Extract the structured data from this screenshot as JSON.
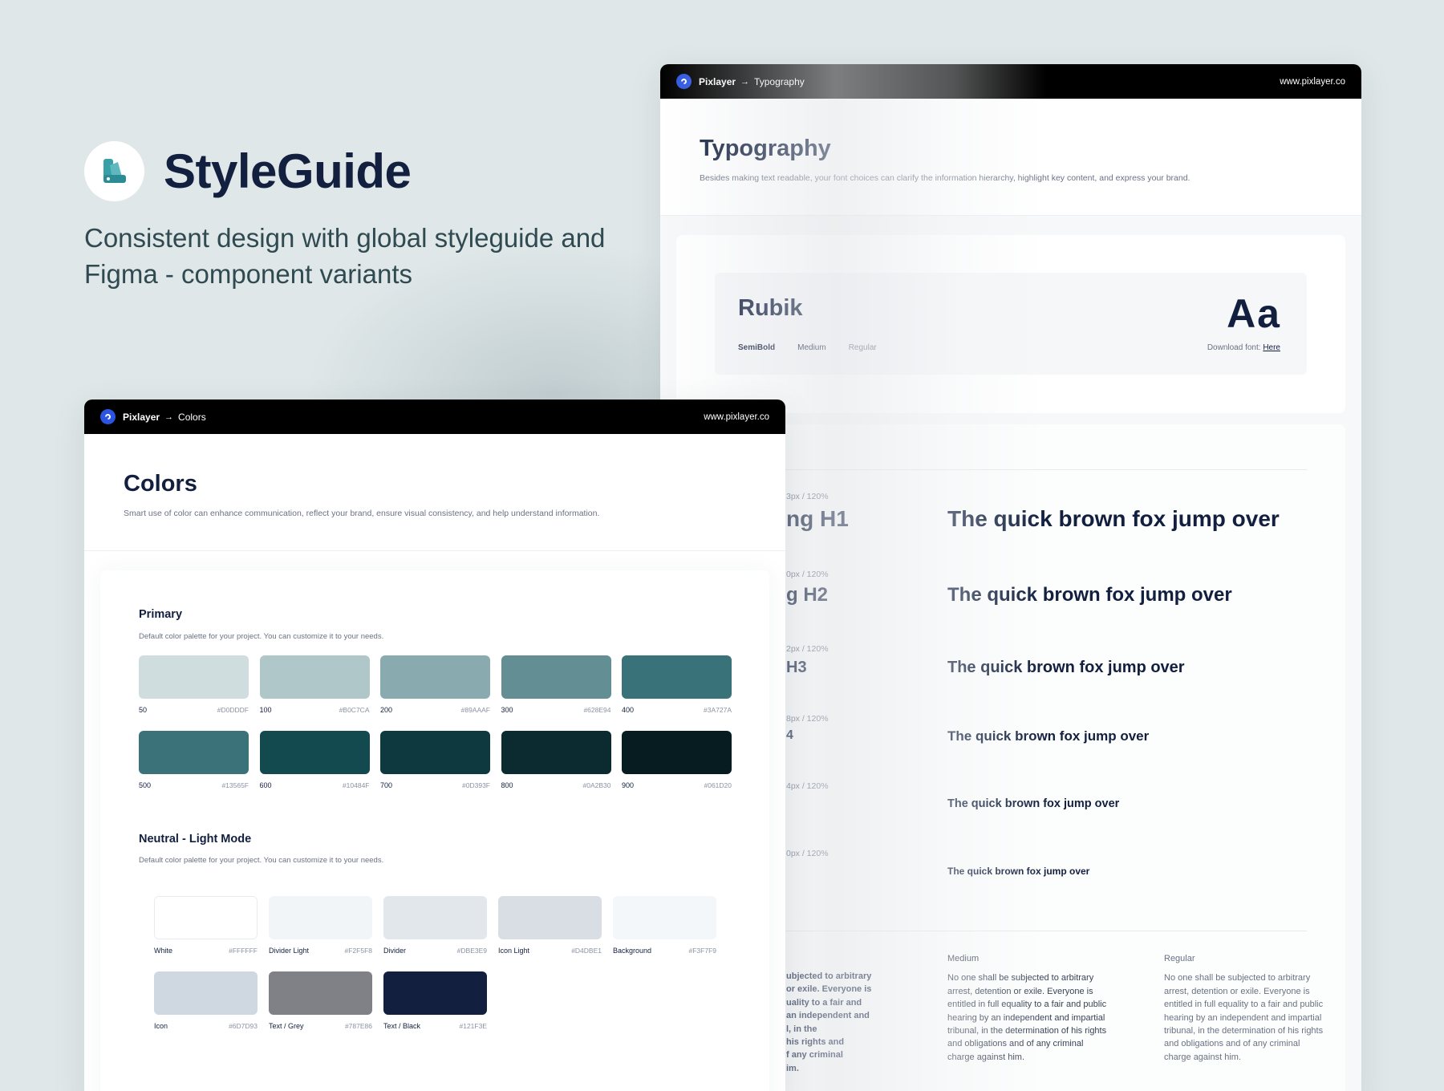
{
  "hero": {
    "title": "StyleGuide",
    "subtitle": "Consistent design with global styleguide and Figma - component variants",
    "logo_icon": "swatch-book-icon",
    "accent": "#3aa0a8"
  },
  "typography_window": {
    "topbar": {
      "brand": "Pixlayer",
      "arrow": "→",
      "page": "Typography",
      "url": "www.pixlayer.co"
    },
    "title": "Typography",
    "description": "Besides making text readable, your font choices can clarify the information hierarchy, highlight key content, and express your brand.",
    "font": {
      "name": "Rubik",
      "weights": [
        "SemiBold",
        "Medium",
        "Regular"
      ],
      "sample": "Aa",
      "download_label": "Download font:",
      "download_link": "Here"
    },
    "scale": [
      {
        "spec": "3px / 120%",
        "label": "ng H1",
        "sample": "The quick brown fox jump over"
      },
      {
        "spec": "0px / 120%",
        "label": "g H2",
        "sample": "The quick brown fox jump over"
      },
      {
        "spec": "2px / 120%",
        "label": "H3",
        "sample": "The quick brown fox jump over"
      },
      {
        "spec": "8px / 120%",
        "label": "4",
        "sample": "The quick brown fox jump over"
      },
      {
        "spec": "4px / 120%",
        "label": "",
        "sample": "The quick brown fox jump over"
      },
      {
        "spec": "0px / 120%",
        "label": "",
        "sample": "The quick brown fox jump over"
      }
    ],
    "paragraphs": {
      "cut_text": "ubjected to arbitrary\n or exile. Everyone is\nuality to a fair and\n an independent and\nl, in the\n his rights and\nf any criminal\nim.",
      "medium_heading": "Medium",
      "medium_text": "No one shall be subjected to arbitrary arrest, detention or exile. Everyone is entitled in full equality to a fair and public hearing by an independent and impartial tribunal, in the determination of his rights and obligations and of any criminal charge against him.",
      "regular_heading": "Regular",
      "regular_text": "No one shall be subjected to arbitrary arrest, detention or exile. Everyone is entitled in full equality to a fair and public hearing by an independent and impartial tribunal, in the determination of his rights and obligations and of any criminal charge against him."
    }
  },
  "colors_window": {
    "topbar": {
      "brand": "Pixlayer",
      "arrow": "→",
      "page": "Colors",
      "url": "www.pixlayer.co"
    },
    "title": "Colors",
    "description": "Smart use of color can enhance communication, reflect your brand, ensure visual consistency, and help understand information.",
    "primary": {
      "title": "Primary",
      "description": "Default color palette for your project. You can customize it to your needs.",
      "swatches": [
        {
          "name": "50",
          "hex": "#D0DDDF",
          "color": "#D0DDDF"
        },
        {
          "name": "100",
          "hex": "#B0C7CA",
          "color": "#B0C7CA"
        },
        {
          "name": "200",
          "hex": "#89AAAF",
          "color": "#89AAAF"
        },
        {
          "name": "300",
          "hex": "#628E94",
          "color": "#628E94"
        },
        {
          "name": "400",
          "hex": "#3A727A",
          "color": "#3A727A"
        },
        {
          "name": "500",
          "hex": "#13565F",
          "color": "#3B7279"
        },
        {
          "name": "600",
          "hex": "#10484F",
          "color": "#134A50"
        },
        {
          "name": "700",
          "hex": "#0D393F",
          "color": "#0E3A3F"
        },
        {
          "name": "800",
          "hex": "#0A2B30",
          "color": "#0B2B30"
        },
        {
          "name": "900",
          "hex": "#061D20",
          "color": "#071C20"
        }
      ]
    },
    "neutral": {
      "title": "Neutral  - Light Mode",
      "description": "Default color palette for your project. You can customize it to your needs.",
      "swatches": [
        {
          "name": "White",
          "hex": "#FFFFFF",
          "color": "#FFFFFF"
        },
        {
          "name": "Divider Light",
          "hex": "#F2F5F8",
          "color": "#F2F5F8"
        },
        {
          "name": "Divider",
          "hex": "#DBE3E9",
          "color": "#E2E7EC"
        },
        {
          "name": "Icon Light",
          "hex": "#D4DBE1",
          "color": "#D8DEE3"
        },
        {
          "name": "Background",
          "hex": "#F3F7F9",
          "color": "#F3F7F9"
        },
        {
          "name": "Icon",
          "hex": "#6D7D93",
          "color": "#CFD8E1"
        },
        {
          "name": "Text / Grey",
          "hex": "#787E86",
          "color": "#7F8187"
        },
        {
          "name": "Text / Black",
          "hex": "#121F3E",
          "color": "#121F3E"
        }
      ]
    }
  }
}
